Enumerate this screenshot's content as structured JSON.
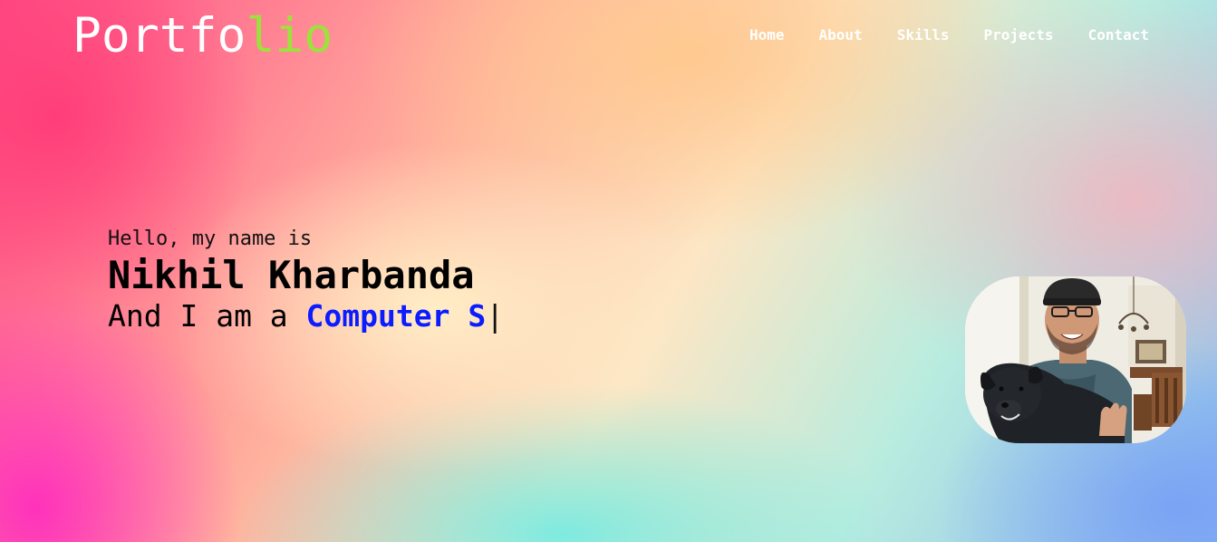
{
  "header": {
    "logo_main": "Portfo",
    "logo_accent": "lio",
    "nav": [
      {
        "label": "Home"
      },
      {
        "label": "About"
      },
      {
        "label": "Skills"
      },
      {
        "label": "Projects"
      },
      {
        "label": "Contact"
      }
    ]
  },
  "hero": {
    "greeting": "Hello, my name is",
    "name": "Nikhil Kharbanda",
    "role_prefix": "And I am a ",
    "role_typed": "Computer S",
    "cursor": "|"
  },
  "colors": {
    "logo_accent": "#9be33a",
    "role_highlight": "#0b1cff",
    "nav_text": "#ffffff"
  }
}
